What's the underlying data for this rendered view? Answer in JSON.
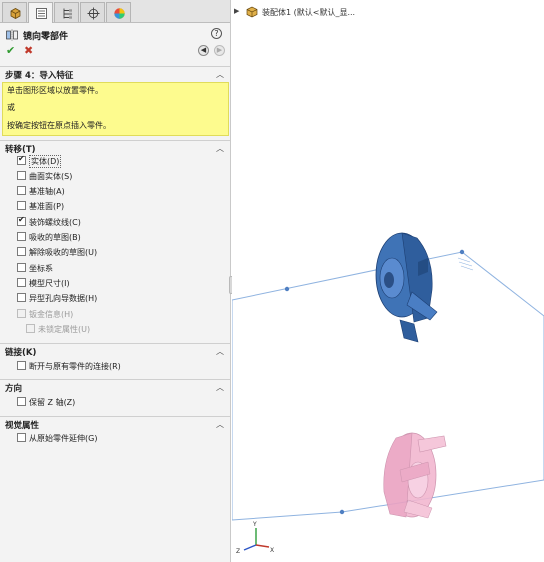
{
  "property_manager": {
    "title": "镜向零部件",
    "help": "?",
    "ok": "✔",
    "cancel": "✖",
    "back": "◀",
    "next": "▶",
    "step_header": "步骤 4：导入特征",
    "messages": [
      "单击图形区域以放置零件。",
      "或",
      "按确定按钮在原点插入零件。"
    ],
    "transfer_header": "转移(T)",
    "transfer_items": [
      {
        "label": "实体(D)",
        "checked": true,
        "disabled": false
      },
      {
        "label": "曲面实体(S)",
        "checked": false,
        "disabled": false
      },
      {
        "label": "基准轴(A)",
        "checked": false,
        "disabled": false
      },
      {
        "label": "基准面(P)",
        "checked": false,
        "disabled": false
      },
      {
        "label": "装饰螺纹线(C)",
        "checked": true,
        "disabled": false
      },
      {
        "label": "吸收的草图(B)",
        "checked": false,
        "disabled": false
      },
      {
        "label": "解除吸收的草图(U)",
        "checked": false,
        "disabled": false
      },
      {
        "label": "坐标系",
        "checked": false,
        "disabled": false
      },
      {
        "label": "模型尺寸(I)",
        "checked": false,
        "disabled": false
      },
      {
        "label": "异型孔向导数据(H)",
        "checked": false,
        "disabled": false
      },
      {
        "label": "钣金信息(H)",
        "checked": false,
        "disabled": true
      },
      {
        "label": "未锁定属性(U)",
        "checked": false,
        "disabled": true
      }
    ],
    "link_header": "链接(K)",
    "link_item": "断开与原有零件的连接(R)",
    "direction_header": "方向",
    "direction_item": "保留 Z 轴(Z)",
    "visual_header": "视觉属性",
    "visual_item": "从原始零件延伸(G)"
  },
  "graphics": {
    "breadcrumb": "装配体1  (默认<默认_显...",
    "triad_x": "X",
    "triad_y": "Y",
    "triad_z": "Z"
  },
  "colors": {
    "original_part": "#3f73b6",
    "mirror_preview": "#f2b7d0",
    "plane_edge": "#8fb3e0",
    "message_bg": "#fdfb8e"
  }
}
